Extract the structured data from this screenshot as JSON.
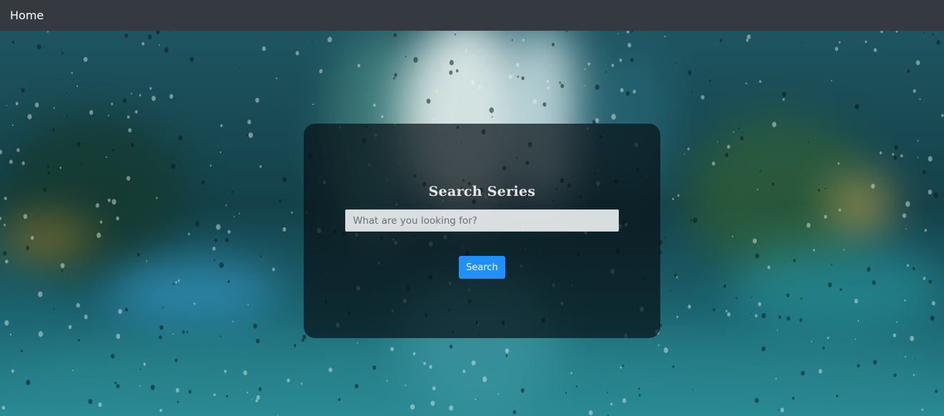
{
  "navbar": {
    "home_label": "Home",
    "background": "#343a40"
  },
  "search_card": {
    "title": "Search Series",
    "input_placeholder": "What are you looking for?",
    "input_value": "",
    "button_label": "Search",
    "button_color": "#1e90ff"
  },
  "background": {
    "description_icon": "rain-window-image"
  }
}
